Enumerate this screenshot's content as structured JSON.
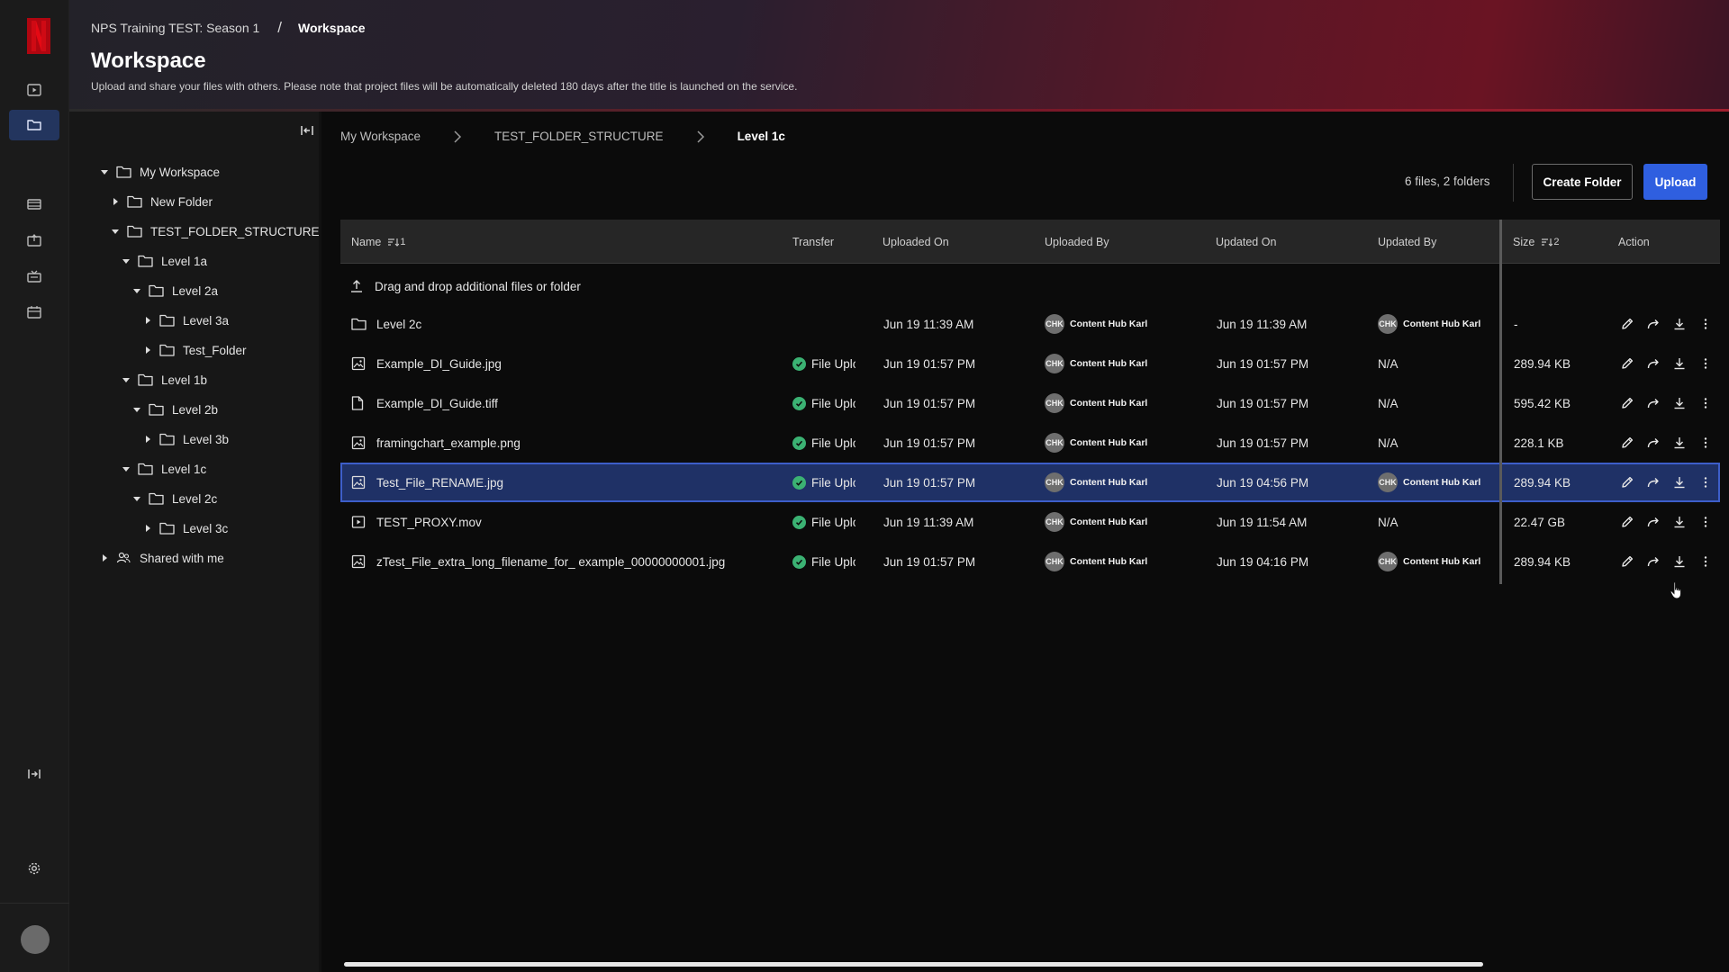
{
  "header": {
    "project": "NPS Training TEST: Season 1",
    "separator": "/",
    "section": "Workspace",
    "title": "Workspace",
    "subtitle": "Upload and share your files with others. Please note that project files will be automatically deleted 180 days after the title is launched on the service."
  },
  "tree": {
    "items": [
      {
        "label": "My Workspace",
        "expanded": true
      },
      {
        "label": "New Folder",
        "expanded": false
      },
      {
        "label": "TEST_FOLDER_STRUCTURE",
        "expanded": true
      },
      {
        "label": "Level 1a",
        "expanded": true
      },
      {
        "label": "Level 2a",
        "expanded": true
      },
      {
        "label": "Level 3a",
        "expanded": false
      },
      {
        "label": "Test_Folder",
        "expanded": false
      },
      {
        "label": "Level 1b",
        "expanded": true
      },
      {
        "label": "Level 2b",
        "expanded": true
      },
      {
        "label": "Level 3b",
        "expanded": false
      },
      {
        "label": "Level 1c",
        "expanded": true
      },
      {
        "label": "Level 2c",
        "expanded": true
      },
      {
        "label": "Level 3c",
        "expanded": false
      },
      {
        "label": "Shared with me",
        "expanded": false
      }
    ]
  },
  "breadcrumb": {
    "items": [
      "My Workspace",
      "TEST_FOLDER_STRUCTURE",
      "Level 1c"
    ]
  },
  "toolbar": {
    "counts": "6 files, 2 folders",
    "create_folder_label": "Create Folder",
    "upload_label": "Upload"
  },
  "table": {
    "columns": {
      "name": "Name",
      "name_sort": "1",
      "transfer": "Transfer",
      "uploaded_on": "Uploaded On",
      "uploaded_by": "Uploaded By",
      "updated_on": "Updated On",
      "updated_by": "Updated By",
      "size": "Size",
      "size_sort": "2",
      "action": "Action"
    },
    "drop_label": "Drag and drop additional files or folder",
    "avatar_initials": "CHK",
    "rows": [
      {
        "name": "Level 2c",
        "icon": "folder-icon",
        "transfer": "",
        "uploaded_on": "Jun 19 11:39 AM",
        "uploaded_by": "Content Hub Karl",
        "updated_on": "Jun 19 11:39 AM",
        "updated_by": "Content Hub Karl",
        "size": "-"
      },
      {
        "name": "Example_DI_Guide.jpg",
        "icon": "image-icon",
        "transfer": "File Uploa",
        "uploaded_on": "Jun 19 01:57 PM",
        "uploaded_by": "Content Hub Karl",
        "updated_on": "Jun 19 01:57 PM",
        "updated_by": "N/A",
        "size": "289.94 KB"
      },
      {
        "name": "Example_DI_Guide.tiff",
        "icon": "file-icon",
        "transfer": "File Uploa",
        "uploaded_on": "Jun 19 01:57 PM",
        "uploaded_by": "Content Hub Karl",
        "updated_on": "Jun 19 01:57 PM",
        "updated_by": "N/A",
        "size": "595.42 KB"
      },
      {
        "name": "framingchart_example.png",
        "icon": "image-icon",
        "transfer": "File Uploa",
        "uploaded_on": "Jun 19 01:57 PM",
        "uploaded_by": "Content Hub Karl",
        "updated_on": "Jun 19 01:57 PM",
        "updated_by": "N/A",
        "size": "228.1 KB"
      },
      {
        "name": "Test_File_RENAME.jpg",
        "icon": "image-icon",
        "transfer": "File Uploa",
        "uploaded_on": "Jun 19 01:57 PM",
        "uploaded_by": "Content Hub Karl",
        "updated_on": "Jun 19 04:56 PM",
        "updated_by": "Content Hub Karl",
        "size": "289.94 KB",
        "selected": true
      },
      {
        "name": "TEST_PROXY.mov",
        "icon": "video-icon",
        "transfer": "File Uploa",
        "uploaded_on": "Jun 19 11:39 AM",
        "uploaded_by": "Content Hub Karl",
        "updated_on": "Jun 19 11:54 AM",
        "updated_by": "N/A",
        "size": "22.47 GB"
      },
      {
        "name": "zTest_File_extra_long_filename_for_ example_00000000001.jpg",
        "icon": "image-icon",
        "transfer": "File Uploa",
        "uploaded_on": "Jun 19 01:57 PM",
        "uploaded_by": "Content Hub Karl",
        "updated_on": "Jun 19 04:16 PM",
        "updated_by": "Content Hub Karl",
        "size": "289.94 KB"
      }
    ]
  },
  "colors": {
    "accent": "#2f5fe0",
    "selected_row": "#1f3166",
    "success": "#3bb273",
    "brand_red": "#e50914"
  }
}
